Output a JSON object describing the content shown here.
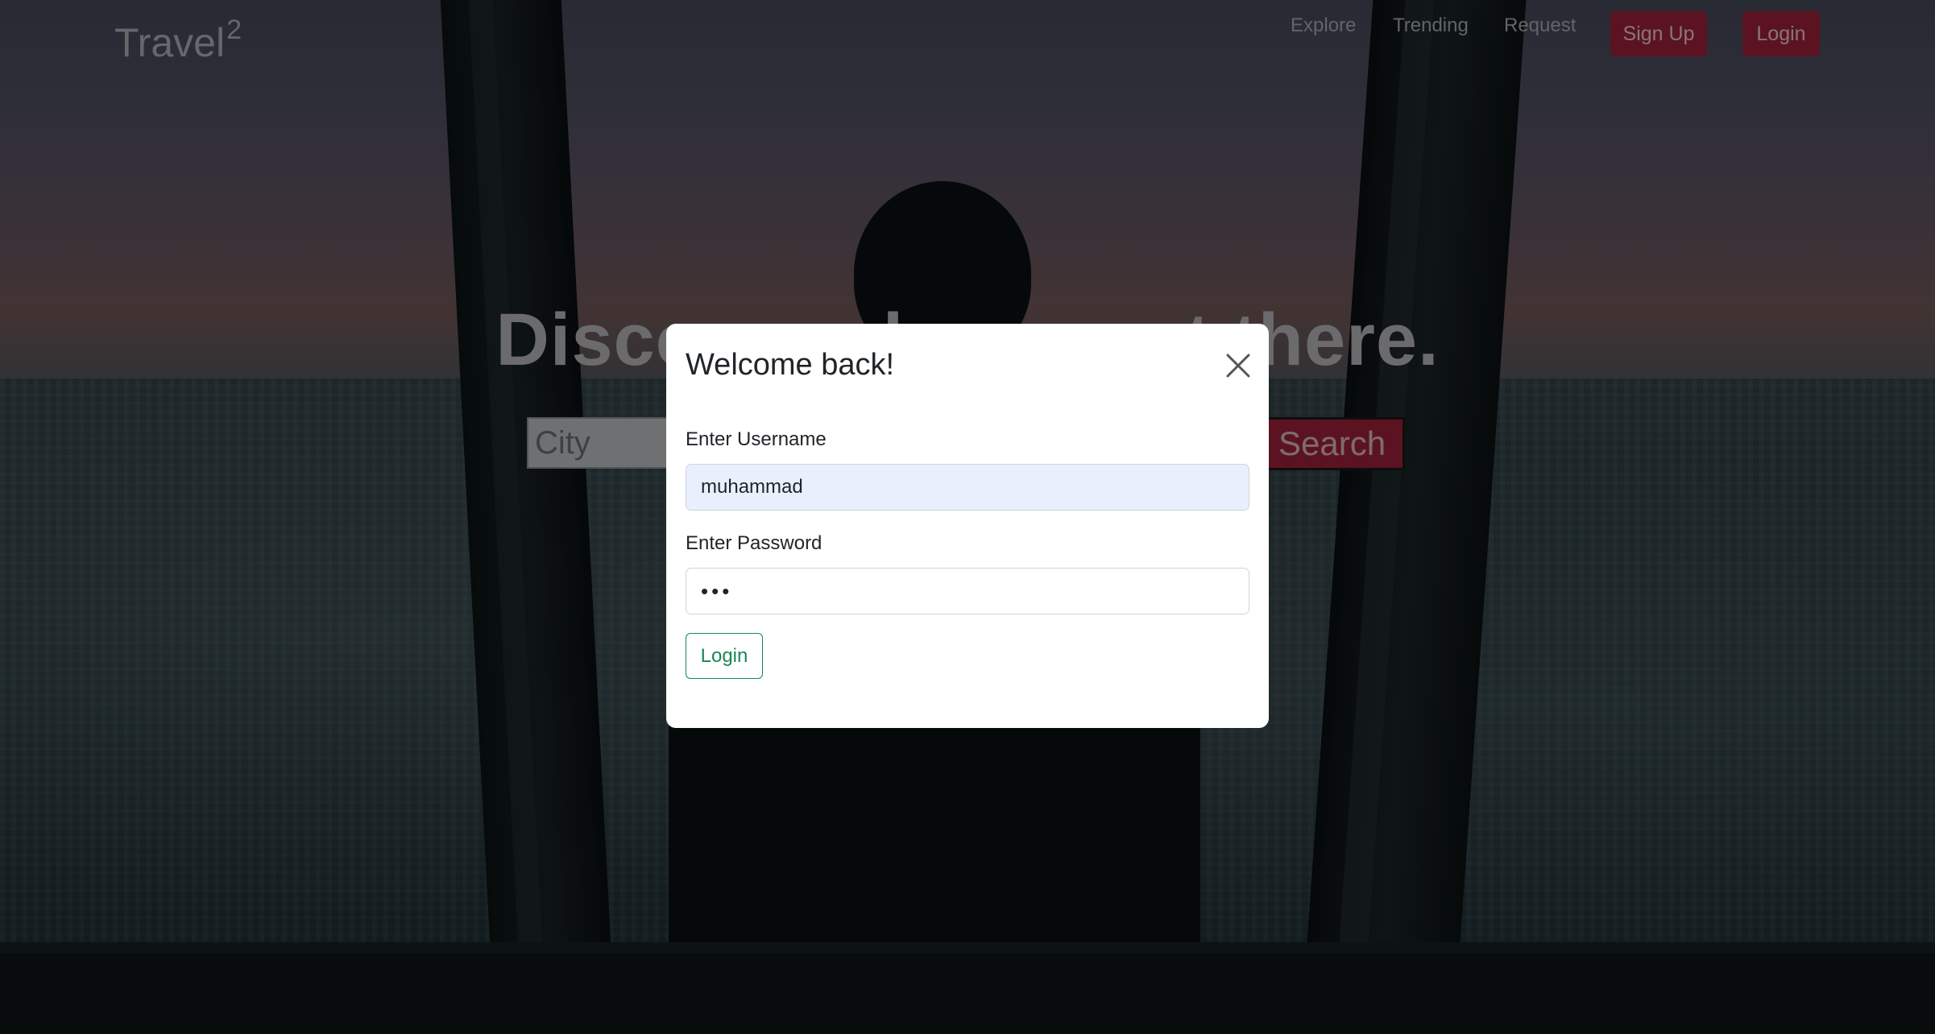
{
  "header": {
    "brand": "Travel",
    "brand_sup": "2",
    "nav": {
      "explore": "Explore",
      "trending": "Trending",
      "request": "Request",
      "signup": "Sign Up",
      "login": "Login"
    }
  },
  "hero": {
    "title": "Discover places out there.",
    "search_placeholder": "City",
    "search_button": "Search"
  },
  "modal": {
    "title": "Welcome back!",
    "username_label": "Enter Username",
    "username_value": "muhammad",
    "password_label": "Enter Password",
    "password_value": "•••",
    "submit_label": "Login",
    "close_icon": "close-icon"
  },
  "colors": {
    "accent": "#a8233c",
    "submit": "#198754",
    "autofill_bg": "#e8f0fe"
  }
}
